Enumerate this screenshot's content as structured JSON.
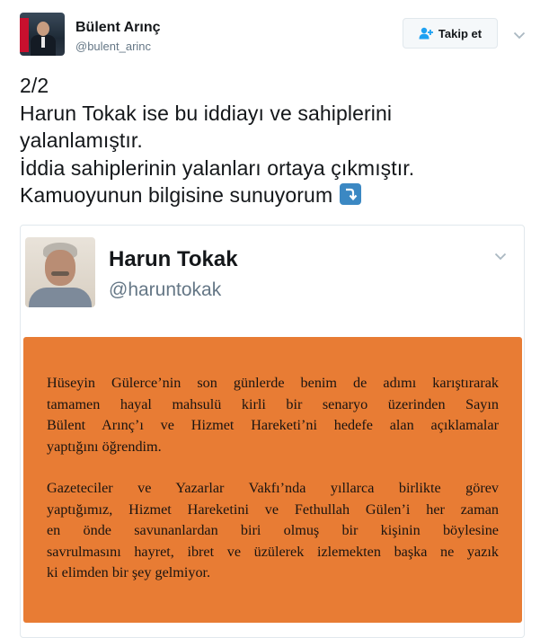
{
  "author": {
    "display_name": "Bülent Arınç",
    "screen_name": "@bulent_arinc",
    "follow_label": "Takip et"
  },
  "tweet": {
    "lines": [
      "2/2",
      "Harun Tokak ise bu iddiayı ve sahiplerini",
      "yalanlamıştır.",
      "İddia sahiplerinin yalanları ortaya çıkmıştır.",
      "Kamuoyunun bilgisine sunuyorum"
    ]
  },
  "quoted": {
    "display_name": "Harun Tokak",
    "screen_name": "@haruntokak",
    "statement": {
      "paragraph1": [
        "Hüseyin Gülerce’nin son günlerde benim de adımı karıştırarak",
        "tamamen hayal mahsulü kirli bir senaryo üzerinden Sayın",
        "Bülent Arınç’ı ve Hizmet Hareketi’ni hedefe alan açıklamalar",
        "yaptığını öğrendim."
      ],
      "paragraph2": [
        "Gazeteciler ve Yazarlar Vakfı’nda yıllarca birlikte görev",
        "yaptığımız, Hizmet Hareketini ve Fethullah Gülen’i her zaman",
        "en önde savunanlardan biri olmuş bir kişinin böylesine",
        "savrulmasını hayret, ibret ve üzülerek izlemekten başka ne yazık",
        "ki elimden bir şey gelmiyor."
      ]
    }
  },
  "colors": {
    "statement_background": "#e87c34",
    "emoji_blue": "#3b88c3",
    "link_gray": "#657786"
  },
  "icons": {
    "follow": "add-user-icon",
    "menu": "chevron-down-icon",
    "emoji": "arrow-curving-down-emoji-icon"
  }
}
